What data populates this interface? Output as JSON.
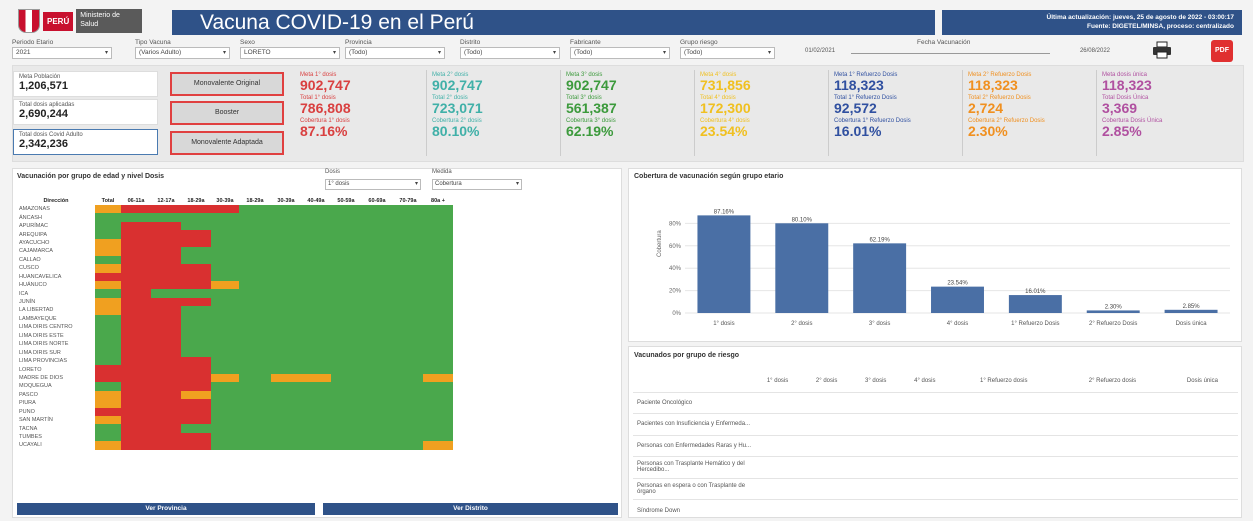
{
  "header": {
    "brand_peru": "PERÚ",
    "brand_ministry": "Ministerio de Salud",
    "title": "Vacuna COVID-19 en el Perú",
    "update_line1": "Última actualización: jueves, 25 de agosto de 2022 - 03:00:17",
    "update_line2": "Fuente: DIGETEL/MINSA, proceso: centralizado"
  },
  "filters": [
    {
      "label": "Periodo Etario",
      "value": "2021"
    },
    {
      "label": "Tipo Vacuna",
      "value": "(Varios Adulto)"
    },
    {
      "label": "Sexo",
      "value": "LORETO"
    },
    {
      "label": "Provincia",
      "value": "(Todo)"
    },
    {
      "label": "Distrito",
      "value": "(Todo)"
    },
    {
      "label": "Fabricante",
      "value": "(Todo)"
    },
    {
      "label": "Grupo riesgo",
      "value": "(Todo)"
    }
  ],
  "slider": {
    "label": "Fecha Vacunación",
    "start": "01/02/2021",
    "end": "26/08/2022"
  },
  "population": [
    {
      "label": "Meta Población",
      "value": "1,206,571"
    },
    {
      "label": "Total dosis aplicadas",
      "value": "2,690,244"
    },
    {
      "label": "Total dosis Covid Adulto",
      "value": "2,342,236"
    }
  ],
  "buttons": [
    "Monovalente Original",
    "Booster",
    "Monovalente Adaptada"
  ],
  "kpis": [
    {
      "color": "#d94040",
      "l1": "Meta 1° dosis",
      "v1": "902,747",
      "l2": "Total 1° dosis",
      "v2": "786,808",
      "l3": "Cobertura 1° dosis",
      "v3": "87.16%"
    },
    {
      "color": "#40b0a8",
      "l1": "Meta 2° dosis",
      "v1": "902,747",
      "l2": "Total 2° dosis",
      "v2": "723,071",
      "l3": "Cobertura 2° dosis",
      "v3": "80.10%"
    },
    {
      "color": "#3c9a3c",
      "l1": "Meta 3° dosis",
      "v1": "902,747",
      "l2": "Total 3° dosis",
      "v2": "561,387",
      "l3": "Cobertura 3° dosis",
      "v3": "62.19%"
    },
    {
      "color": "#f0c020",
      "l1": "Meta 4° dosis",
      "v1": "731,856",
      "l2": "Total 4° dosis",
      "v2": "172,300",
      "l3": "Cobertura 4° dosis",
      "v3": "23.54%"
    },
    {
      "color": "#3050a0",
      "l1": "Meta 1° Refuerzo Dosis",
      "v1": "118,323",
      "l2": "Total 1° Refuerzo Dosis",
      "v2": "92,572",
      "l3": "Cobertura 1° Refuerzo Dosis",
      "v3": "16.01%"
    },
    {
      "color": "#f09020",
      "l1": "Meta 2° Refuerzo Dosis",
      "v1": "118,323",
      "l2": "Total 2° Refuerzo Dosis",
      "v2": "2,724",
      "l3": "Cobertura 2° Refuerzo Dosis",
      "v3": "2.30%"
    },
    {
      "color": "#b050a0",
      "l1": "Meta dosis única",
      "v1": "118,323",
      "l2": "Total Dosis Única",
      "v2": "3,369",
      "l3": "Cobertura Dosis Única",
      "v3": "2.85%"
    }
  ],
  "heatmap": {
    "title": "Vacunación por grupo de edad y nivel Dosis",
    "dosis_label": "Dosis",
    "dosis_value": "1° dosis",
    "medida_label": "Medida",
    "medida_value": "Cobertura",
    "headers": [
      "Dirección",
      "Total",
      "06-11a",
      "12-17a",
      "18-29a",
      "30-39a",
      "40-49a",
      "50-59a",
      "60-69a",
      "70-79a",
      "80a +",
      "18-29a",
      "30-39a",
      "40-49a",
      "50-59a",
      "60-69a",
      "70-79a",
      "80a +"
    ],
    "rows": [
      {
        "name": "AMAZONAS",
        "cells": [
          "o",
          "r",
          "r",
          "r",
          "r",
          "g",
          "g",
          "g",
          "g",
          "g",
          "g",
          "g"
        ]
      },
      {
        "name": "ÁNCASH",
        "cells": [
          "g",
          "g",
          "g",
          "g",
          "g",
          "g",
          "g",
          "g",
          "g",
          "g",
          "g",
          "g"
        ]
      },
      {
        "name": "APURÍMAC",
        "cells": [
          "g",
          "r",
          "r",
          "g",
          "g",
          "g",
          "g",
          "g",
          "g",
          "g",
          "g",
          "g"
        ]
      },
      {
        "name": "AREQUIPA",
        "cells": [
          "g",
          "r",
          "r",
          "r",
          "g",
          "g",
          "g",
          "g",
          "g",
          "g",
          "g",
          "g"
        ]
      },
      {
        "name": "AYACUCHO",
        "cells": [
          "o",
          "r",
          "r",
          "r",
          "g",
          "g",
          "g",
          "g",
          "g",
          "g",
          "g",
          "g"
        ]
      },
      {
        "name": "CAJAMARCA",
        "cells": [
          "o",
          "r",
          "r",
          "g",
          "g",
          "g",
          "g",
          "g",
          "g",
          "g",
          "g",
          "g"
        ]
      },
      {
        "name": "CALLAO",
        "cells": [
          "g",
          "r",
          "r",
          "g",
          "g",
          "g",
          "g",
          "g",
          "g",
          "g",
          "g",
          "g"
        ]
      },
      {
        "name": "CUSCO",
        "cells": [
          "o",
          "r",
          "r",
          "r",
          "g",
          "g",
          "g",
          "g",
          "g",
          "g",
          "g",
          "g"
        ]
      },
      {
        "name": "HUANCAVELICA",
        "cells": [
          "r",
          "r",
          "r",
          "r",
          "g",
          "g",
          "g",
          "g",
          "g",
          "g",
          "g",
          "g"
        ]
      },
      {
        "name": "HUÁNUCO",
        "cells": [
          "o",
          "r",
          "r",
          "r",
          "o",
          "g",
          "g",
          "g",
          "g",
          "g",
          "g",
          "g"
        ]
      },
      {
        "name": "ICA",
        "cells": [
          "g",
          "r",
          "g",
          "g",
          "g",
          "g",
          "g",
          "g",
          "g",
          "g",
          "g",
          "g"
        ]
      },
      {
        "name": "JUNÍN",
        "cells": [
          "o",
          "r",
          "r",
          "r",
          "g",
          "g",
          "g",
          "g",
          "g",
          "g",
          "g",
          "g"
        ]
      },
      {
        "name": "LA LIBERTAD",
        "cells": [
          "o",
          "r",
          "r",
          "g",
          "g",
          "g",
          "g",
          "g",
          "g",
          "g",
          "g",
          "g"
        ]
      },
      {
        "name": "LAMBAYEQUE",
        "cells": [
          "g",
          "r",
          "r",
          "g",
          "g",
          "g",
          "g",
          "g",
          "g",
          "g",
          "g",
          "g"
        ]
      },
      {
        "name": "LIMA DIRIS CENTRO",
        "cells": [
          "g",
          "r",
          "r",
          "g",
          "g",
          "g",
          "g",
          "g",
          "g",
          "g",
          "g",
          "g"
        ]
      },
      {
        "name": "LIMA DIRIS ESTE",
        "cells": [
          "g",
          "r",
          "r",
          "g",
          "g",
          "g",
          "g",
          "g",
          "g",
          "g",
          "g",
          "g"
        ]
      },
      {
        "name": "LIMA DIRIS NORTE",
        "cells": [
          "g",
          "r",
          "r",
          "g",
          "g",
          "g",
          "g",
          "g",
          "g",
          "g",
          "g",
          "g"
        ]
      },
      {
        "name": "LIMA DIRIS SUR",
        "cells": [
          "g",
          "r",
          "r",
          "g",
          "g",
          "g",
          "g",
          "g",
          "g",
          "g",
          "g",
          "g"
        ]
      },
      {
        "name": "LIMA PROVINCIAS",
        "cells": [
          "g",
          "r",
          "r",
          "r",
          "g",
          "g",
          "g",
          "g",
          "g",
          "g",
          "g",
          "g"
        ]
      },
      {
        "name": "LORETO",
        "cells": [
          "r",
          "r",
          "r",
          "r",
          "g",
          "g",
          "g",
          "g",
          "g",
          "g",
          "g",
          "g"
        ]
      },
      {
        "name": "MADRE DE DIOS",
        "cells": [
          "r",
          "r",
          "r",
          "r",
          "o",
          "g",
          "o",
          "o",
          "g",
          "g",
          "g",
          "o"
        ]
      },
      {
        "name": "MOQUEGUA",
        "cells": [
          "g",
          "r",
          "r",
          "r",
          "g",
          "g",
          "g",
          "g",
          "g",
          "g",
          "g",
          "g"
        ]
      },
      {
        "name": "PASCO",
        "cells": [
          "o",
          "r",
          "r",
          "o",
          "g",
          "g",
          "g",
          "g",
          "g",
          "g",
          "g",
          "g"
        ]
      },
      {
        "name": "PIURA",
        "cells": [
          "o",
          "r",
          "r",
          "r",
          "g",
          "g",
          "g",
          "g",
          "g",
          "g",
          "g",
          "g"
        ]
      },
      {
        "name": "PUNO",
        "cells": [
          "r",
          "r",
          "r",
          "r",
          "g",
          "g",
          "g",
          "g",
          "g",
          "g",
          "g",
          "g"
        ]
      },
      {
        "name": "SAN MARTÍN",
        "cells": [
          "o",
          "r",
          "r",
          "r",
          "g",
          "g",
          "g",
          "g",
          "g",
          "g",
          "g",
          "g"
        ]
      },
      {
        "name": "TACNA",
        "cells": [
          "g",
          "r",
          "r",
          "g",
          "g",
          "g",
          "g",
          "g",
          "g",
          "g",
          "g",
          "g"
        ]
      },
      {
        "name": "TUMBES",
        "cells": [
          "g",
          "r",
          "r",
          "r",
          "g",
          "g",
          "g",
          "g",
          "g",
          "g",
          "g",
          "g"
        ]
      },
      {
        "name": "UCAYALI",
        "cells": [
          "o",
          "r",
          "r",
          "r",
          "g",
          "g",
          "g",
          "g",
          "g",
          "g",
          "g",
          "o"
        ]
      }
    ]
  },
  "bottom_buttons": [
    "Ver Provincia",
    "Ver Distrito"
  ],
  "chart_data": {
    "type": "bar",
    "title": "Cobertura de vacunación según grupo etario",
    "ylabel": "Cobertura",
    "categories": [
      "1° dosis",
      "2° dosis",
      "3° dosis",
      "4° dosis",
      "1° Refuerzo Dosis",
      "2° Refuerzo Dosis",
      "Dosis única"
    ],
    "values": [
      87.16,
      80.1,
      62.19,
      23.54,
      16.01,
      2.3,
      2.85
    ],
    "ylim": [
      0,
      100
    ],
    "yticks": [
      "0%",
      "20%",
      "40%",
      "60%",
      "80%"
    ],
    "bar_color": "#4a6fa5"
  },
  "risk": {
    "title": "Vacunados por grupo de riesgo",
    "headers": [
      "1° dosis",
      "2° dosis",
      "3° dosis",
      "4° dosis",
      "1° Refuerzo dosis",
      "2° Refuerzo dosis",
      "Dosis única"
    ],
    "rows": [
      "Paciente Oncológico",
      "Pacientes con Insuficiencia y Enfermeda...",
      "Personas con Enfermedades Raras y Hu...",
      "Personas con Trasplante Hemático y del Hercedibo...",
      "Personas en espera o con Trasplante de órgano",
      "Síndrome Down"
    ]
  }
}
